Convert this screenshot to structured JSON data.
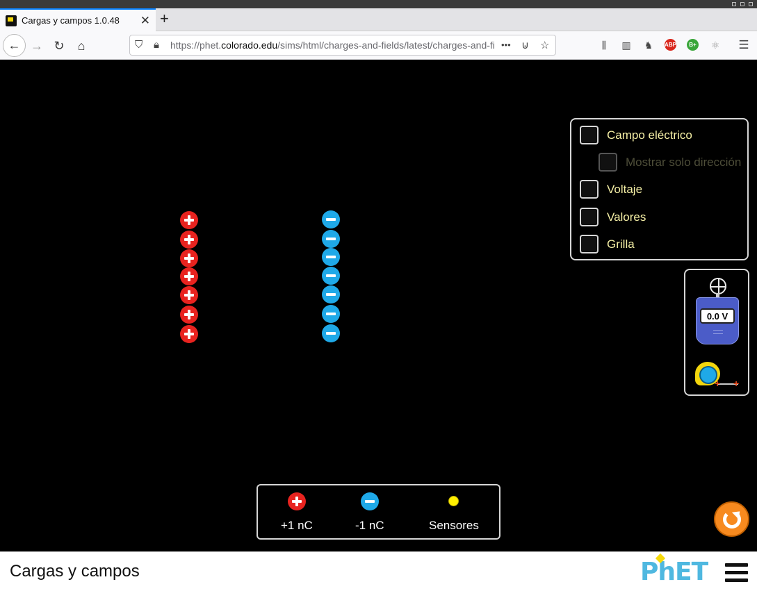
{
  "browser": {
    "tab_title": "Cargas y campos 1.0.48",
    "tab_close": "✕",
    "new_tab": "+",
    "url_prefix": "https://phet.",
    "url_domain": "colorado.edu",
    "url_path": "/sims/html/charges-and-fields/latest/charges-and-fi",
    "url_more": "•••",
    "extension_badges": [
      "ABP",
      "B+"
    ]
  },
  "sim": {
    "charges_on_canvas": {
      "positive_count": 7,
      "negative_count": 7
    },
    "controls": {
      "electric_field": "Campo eléctrico",
      "direction_only": "Mostrar solo dirección",
      "voltage": "Voltaje",
      "values": "Valores",
      "grid": "Grilla",
      "checked": {
        "electric_field": false,
        "direction_only": false,
        "voltage": false,
        "values": false,
        "grid": false
      }
    },
    "voltmeter": {
      "reading": "0.0 V"
    },
    "charge_box": {
      "positive_label": "+1 nC",
      "negative_label": "-1 nC",
      "sensors_label": "Sensores"
    }
  },
  "navbar": {
    "title": "Cargas y campos",
    "logo": "PhET"
  },
  "colors": {
    "positive": "#e8231f",
    "negative": "#1fa9e8",
    "label": "#f6f0a6",
    "sensor": "#ffef00",
    "reset": "#f78a1f"
  }
}
